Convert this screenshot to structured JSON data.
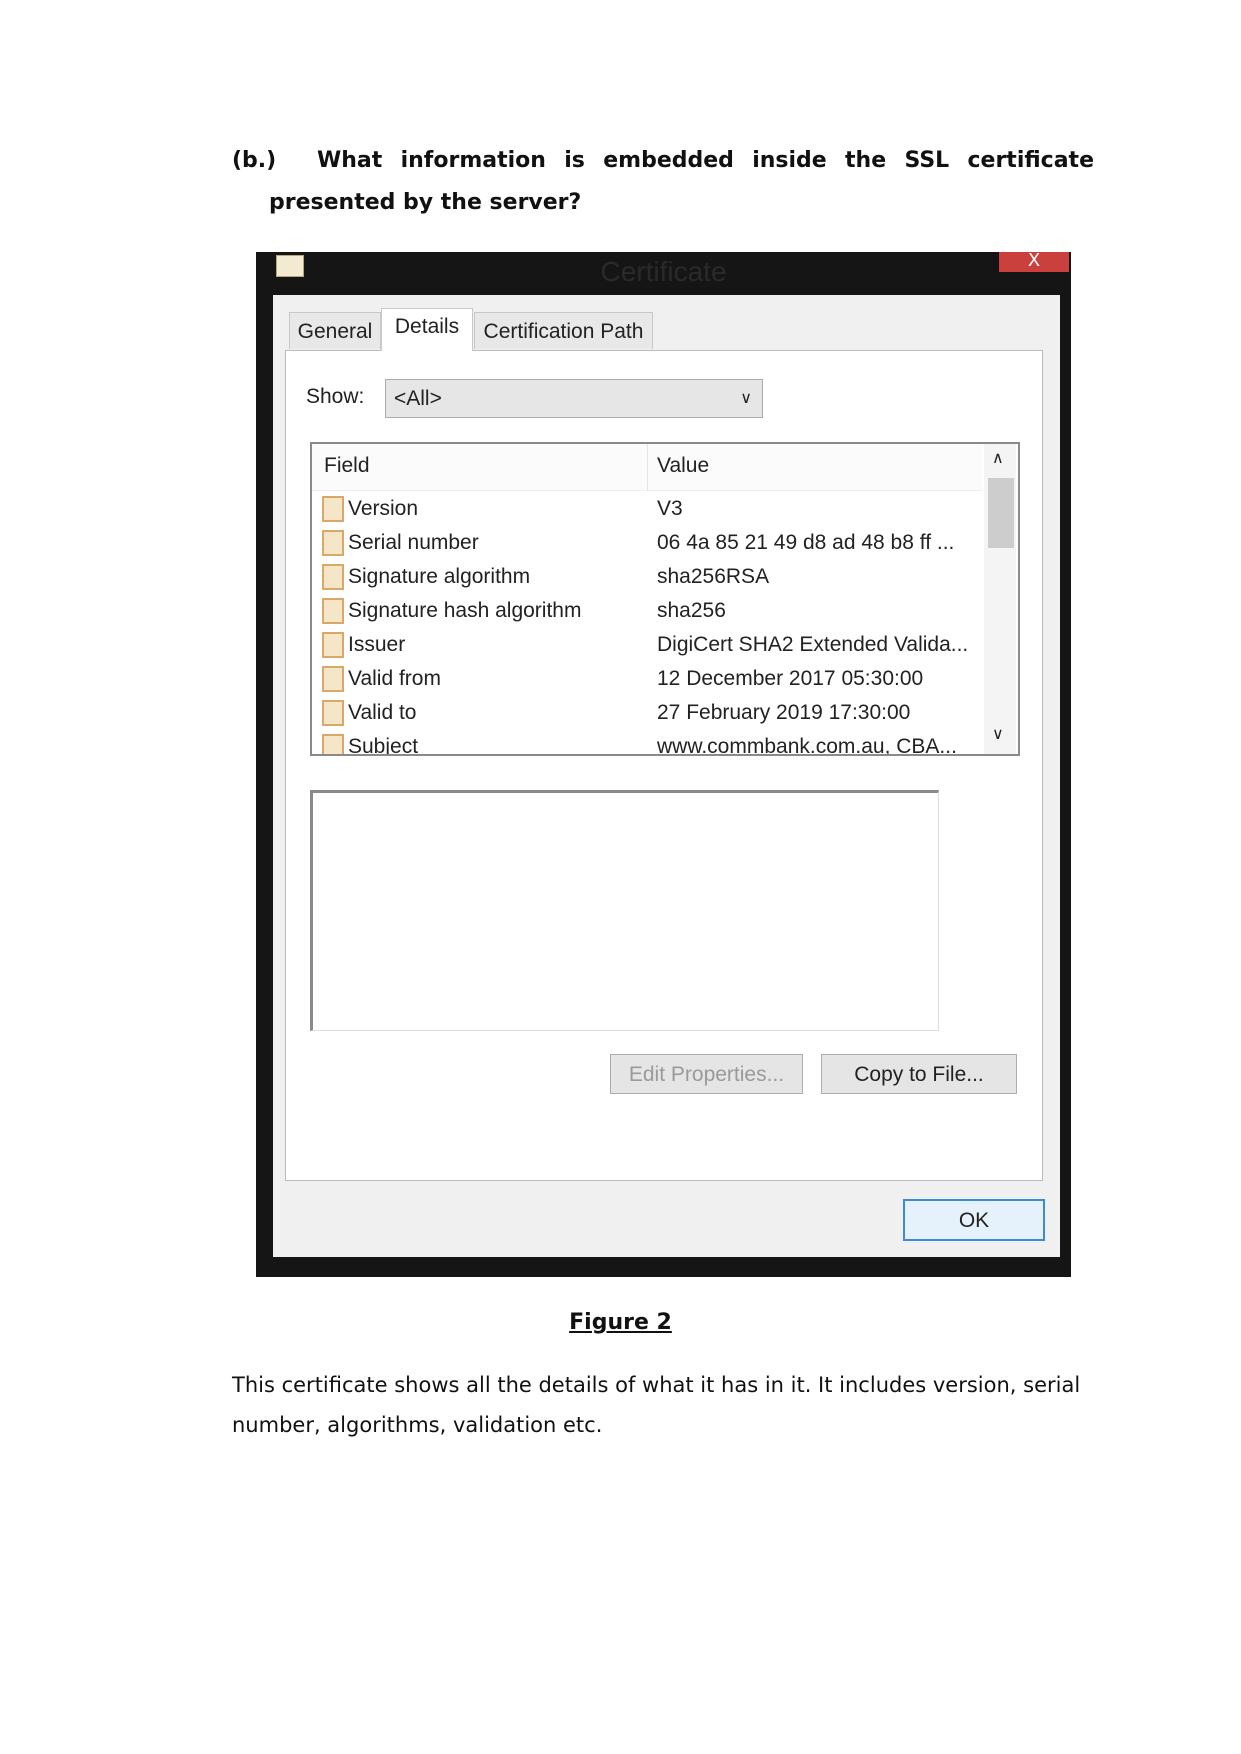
{
  "question": {
    "label": "(b.)",
    "line1": "What  information  is  embedded  inside  the  SSL  certificate",
    "line2": "presented by the server?"
  },
  "dialog": {
    "title": "Certificate",
    "close": "X",
    "tabs": [
      "General",
      "Details",
      "Certification Path"
    ],
    "active_tab": "Details",
    "show_label": "Show:",
    "show_value": "<All>",
    "columns": [
      "Field",
      "Value"
    ],
    "rows": [
      {
        "field": "Version",
        "value": "V3"
      },
      {
        "field": "Serial number",
        "value": "06 4a 85 21 49 d8 ad 48 b8 ff ..."
      },
      {
        "field": "Signature algorithm",
        "value": "sha256RSA"
      },
      {
        "field": "Signature hash algorithm",
        "value": "sha256"
      },
      {
        "field": "Issuer",
        "value": "DigiCert SHA2 Extended Valida..."
      },
      {
        "field": "Valid from",
        "value": "12 December 2017 05:30:00"
      },
      {
        "field": "Valid to",
        "value": "27 February 2019 17:30:00"
      },
      {
        "field": "Subject",
        "value": "www.commbank.com.au, CBA..."
      }
    ],
    "edit_properties": "Edit Properties...",
    "copy_to_file": "Copy to File...",
    "ok": "OK"
  },
  "caption": "Figure 2",
  "paragraph": "This certificate shows all the details of what it has in it. It includes version, serial number, algorithms, validation etc."
}
